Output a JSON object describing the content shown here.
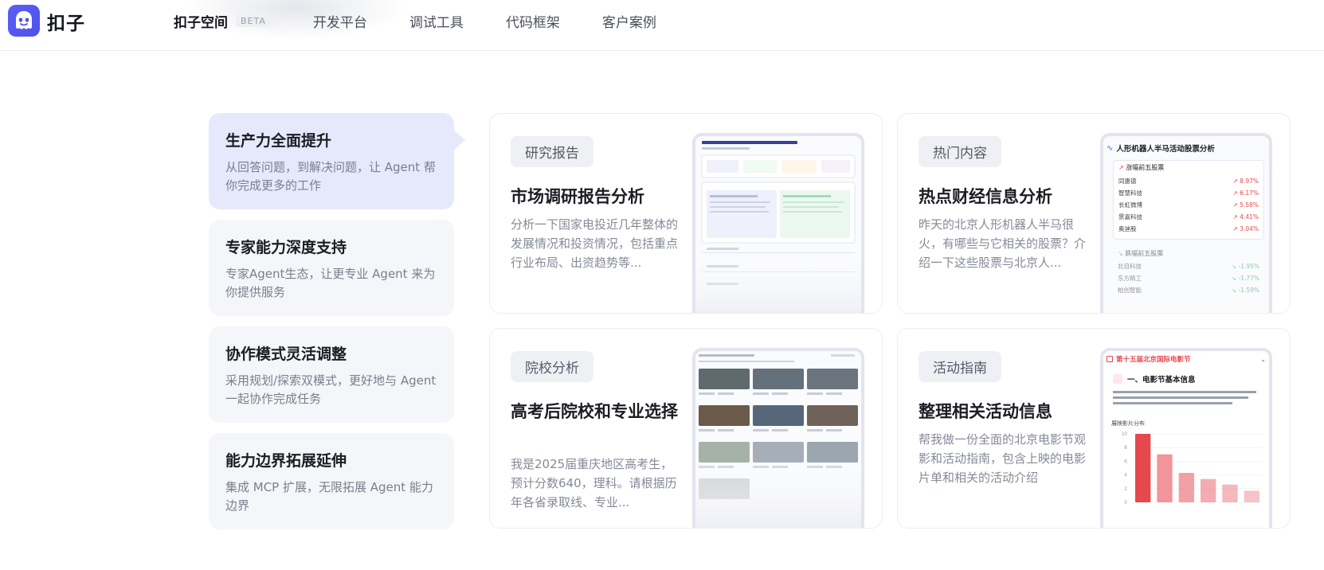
{
  "header": {
    "brand": "扣子",
    "nav": [
      {
        "label": "扣子空间",
        "badge": "BETA"
      },
      {
        "label": "开发平台"
      },
      {
        "label": "调试工具"
      },
      {
        "label": "代码框架"
      },
      {
        "label": "客户案例"
      }
    ]
  },
  "features": [
    {
      "title": "生产力全面提升",
      "desc": "从回答问题，到解决问题，让 Agent 帮你完成更多的工作"
    },
    {
      "title": "专家能力深度支持",
      "desc": "专家Agent生态，让更专业 Agent 来为你提供服务"
    },
    {
      "title": "协作模式灵活调整",
      "desc": "采用规划/探索双模式，更好地与 Agent 一起协作完成任务"
    },
    {
      "title": "能力边界拓展延伸",
      "desc": "集成 MCP 扩展，无限拓展 Agent 能力边界"
    }
  ],
  "cards": [
    {
      "tag": "研究报告",
      "title": "市场调研报告分析",
      "desc": "分析一下国家电投近几年整体的发展情况和投资情况，包括重点行业布局、出资趋势等..."
    },
    {
      "tag": "热门内容",
      "title": "热点财经信息分析",
      "desc": "昨天的北京人形机器人半马很火，有哪些与它相关的股票？介绍一下这些股票与北京人..."
    },
    {
      "tag": "院校分析",
      "title": "高考后院校和专业选择",
      "desc": "我是2025届重庆地区高考生，预计分数640，理科。请根据历年各省录取线、专业..."
    },
    {
      "tag": "活动指南",
      "title": "整理相关活动信息",
      "desc": "帮我做一份全面的北京电影节观影和活动指南，包含上映的电影片单和相关的活动介绍"
    }
  ],
  "previews": {
    "stock": {
      "title": "人形机器人半马活动股票分析",
      "rise_label": "涨幅前五股票",
      "fall_label": "跌幅前五股票",
      "rise": [
        {
          "name": "同惠德",
          "change": "↗ 8.97%"
        },
        {
          "name": "智慧科技",
          "change": "↗ 6.17%"
        },
        {
          "name": "长虹微博",
          "change": "↗ 5.58%"
        },
        {
          "name": "景嘉科技",
          "change": "↗ 4.41%"
        },
        {
          "name": "奥迪股",
          "change": "↗ 3.04%"
        }
      ],
      "fall": [
        {
          "name": "北自科技",
          "change": "↘ -1.95%"
        },
        {
          "name": "东方精工",
          "change": "↘ -1.77%"
        },
        {
          "name": "柏创智能",
          "change": "↘ -1.59%"
        }
      ]
    },
    "film": {
      "title": "第十五届北京国际电影节",
      "section": "一、电影节基本信息",
      "chart_label": "展映影片分布",
      "chart_ticks": [
        "10",
        "8",
        "6",
        "4",
        "2",
        "0"
      ],
      "chart_values": [
        10,
        7,
        4.3,
        3.4,
        2.6,
        1.7
      ]
    }
  },
  "colors": {
    "accent": "#5b5ff5",
    "active_feature_bg": "#e6e8fb",
    "up": "#e5484d",
    "down": "#30a46c"
  }
}
